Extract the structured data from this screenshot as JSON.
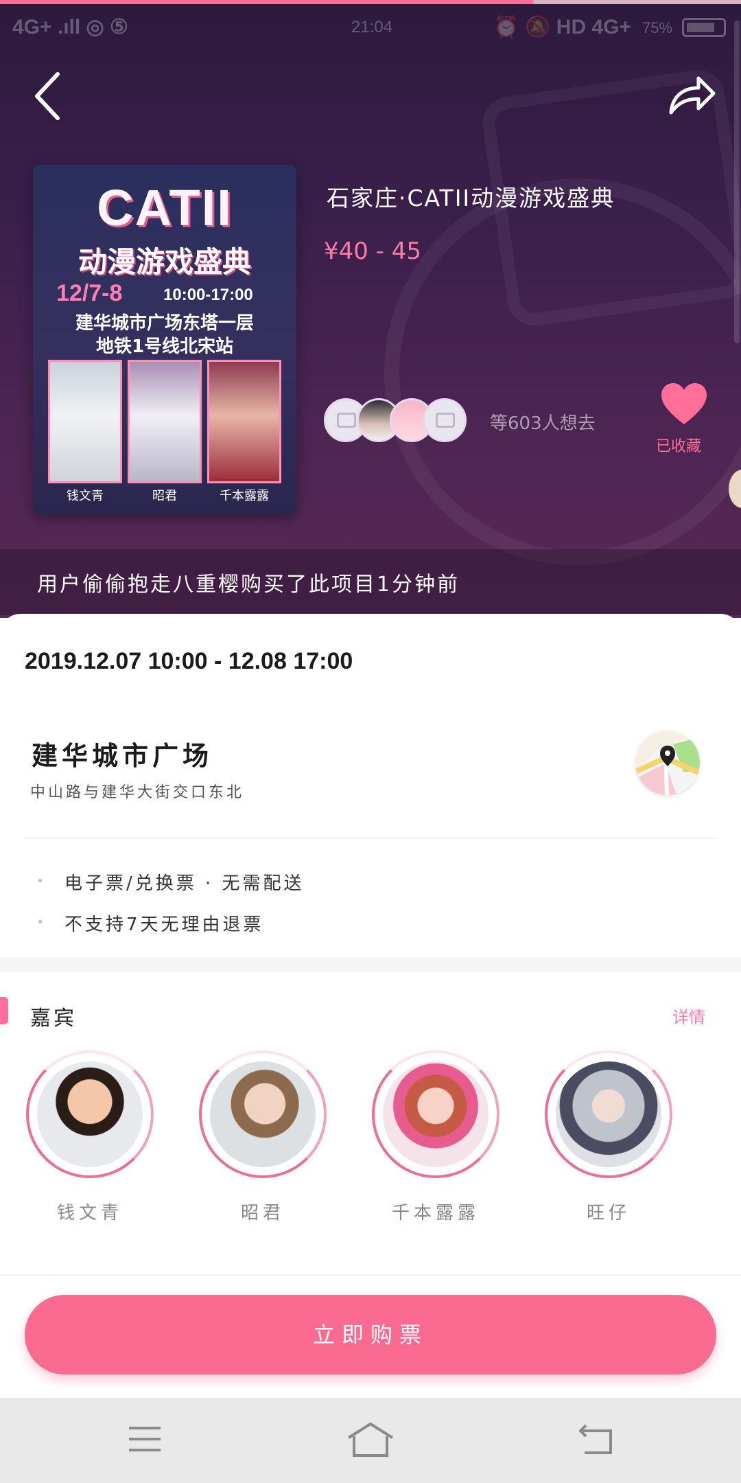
{
  "status_bar": {
    "left": "4G+ .ıll ◎ ⑤",
    "time": "21:04",
    "right": "⏰ 🔕 HD 4G+",
    "battery": "75%"
  },
  "event": {
    "title": "石家庄·CATII动漫游戏盛典",
    "price": "¥40 - 45",
    "want_count_text": "等603人想去",
    "favorite_label": "已收藏",
    "banner_text": "用户偷偷抱走八重樱购买了此项目1分钟前"
  },
  "poster": {
    "title": "CATII",
    "subtitle": "动漫游戏盛典",
    "date": "12/7-8",
    "time": "10:00-17:00",
    "location_line1": "建华城市广场东塔一层",
    "location_line2": "地铁1号线北宋站",
    "guests": [
      "钱文青",
      "昭君",
      "千本露露"
    ]
  },
  "details": {
    "datetime": "2019.12.07 10:00 - 12.08 17:00",
    "venue": "建华城市广场",
    "address": "中山路与建华大街交口东北",
    "features": [
      "电子票/兑换票 · 无需配送",
      "不支持7天无理由退票"
    ]
  },
  "guests_section": {
    "title": "嘉宾",
    "detail_link": "详情",
    "guests": [
      {
        "name": "钱文青"
      },
      {
        "name": "昭君"
      },
      {
        "name": "千本露露"
      },
      {
        "name": "旺仔"
      }
    ]
  },
  "buy_button": {
    "label": "立即购票"
  },
  "colors": {
    "accent": "#fb6b91",
    "hero_bg": "#3b1f4b",
    "price": "#ff7aa6"
  },
  "icons": {
    "back": "chevron-left-icon",
    "share": "share-arrow-icon",
    "favorite": "heart-icon",
    "map": "map-pin-icon",
    "nav_menu": "menu-icon",
    "nav_home": "home-icon",
    "nav_back": "back-icon"
  }
}
